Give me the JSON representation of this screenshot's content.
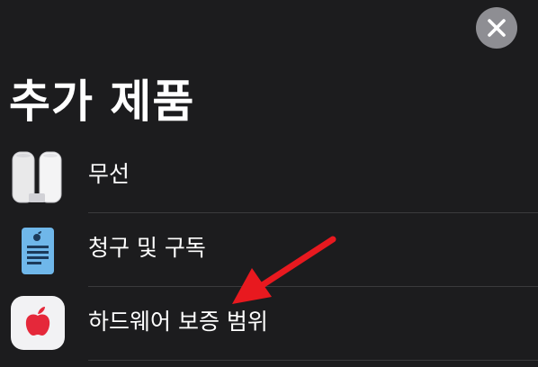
{
  "header": {
    "title": "추가 제품",
    "close_icon": "close-icon"
  },
  "list": {
    "items": [
      {
        "label": "무선",
        "icon": "airport-icon"
      },
      {
        "label": "청구 및 구독",
        "icon": "receipt-icon"
      },
      {
        "label": "하드웨어 보증 범위",
        "icon": "apple-logo-icon"
      }
    ]
  },
  "colors": {
    "background": "#1c1c1e",
    "close_button": "#8e8e93",
    "separator": "#3a3a3c",
    "arrow": "#e8191f",
    "receipt_icon": "#6fb7ea"
  }
}
